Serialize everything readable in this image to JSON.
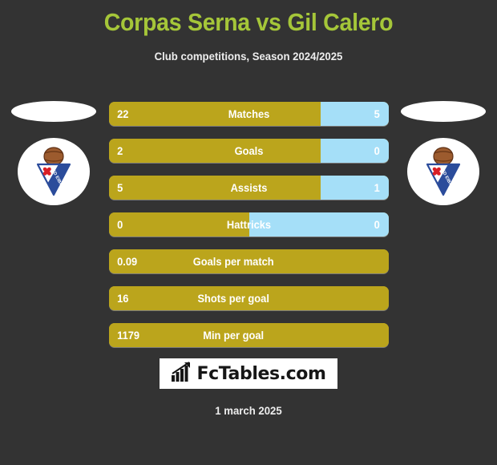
{
  "header": {
    "title": "Corpas Serna vs Gil Calero",
    "subtitle": "Club competitions, Season 2024/2025",
    "title_color": "#A5C639"
  },
  "teams": {
    "home": {
      "badge_name": "sd-eibar-badge",
      "badge_text": "SD EIBAR"
    },
    "away": {
      "badge_name": "sd-eibar-badge",
      "badge_text": "SD EIBAR"
    }
  },
  "colors": {
    "background": "#333333",
    "home_bar": "#BBA51C",
    "away_bar": "#A5DFF8",
    "text": "#FFFFFF"
  },
  "footer": {
    "logo_text": "FcTables.com",
    "logo_icon": "bar-chart-icon",
    "date": "1 march 2025"
  },
  "chart_data": {
    "type": "bar",
    "title": "Corpas Serna vs Gil Calero",
    "subtitle": "Club competitions, Season 2024/2025",
    "orientation": "horizontal",
    "style": "two-sided comparison bars",
    "series": [
      {
        "name": "Corpas Serna",
        "color": "#BBA51C"
      },
      {
        "name": "Gil Calero",
        "color": "#A5DFF8"
      }
    ],
    "categories": [
      "Matches",
      "Goals",
      "Assists",
      "Hattricks",
      "Goals per match",
      "Shots per goal",
      "Min per goal"
    ],
    "rows": [
      {
        "label": "Matches",
        "home": "22",
        "away": "5",
        "home_pct": 75.6,
        "away_pct": 24.4,
        "two_sided": true
      },
      {
        "label": "Goals",
        "home": "2",
        "away": "0",
        "home_pct": 75.6,
        "away_pct": 24.4,
        "two_sided": true
      },
      {
        "label": "Assists",
        "home": "5",
        "away": "1",
        "home_pct": 75.6,
        "away_pct": 24.4,
        "two_sided": true
      },
      {
        "label": "Hattricks",
        "home": "0",
        "away": "0",
        "home_pct": 50.0,
        "away_pct": 50.0,
        "two_sided": true
      },
      {
        "label": "Goals per match",
        "home": "0.09",
        "away": "",
        "home_pct": 100,
        "away_pct": 0,
        "two_sided": false
      },
      {
        "label": "Shots per goal",
        "home": "16",
        "away": "",
        "home_pct": 100,
        "away_pct": 0,
        "two_sided": false
      },
      {
        "label": "Min per goal",
        "home": "1179",
        "away": "",
        "home_pct": 100,
        "away_pct": 0,
        "two_sided": false
      }
    ]
  }
}
